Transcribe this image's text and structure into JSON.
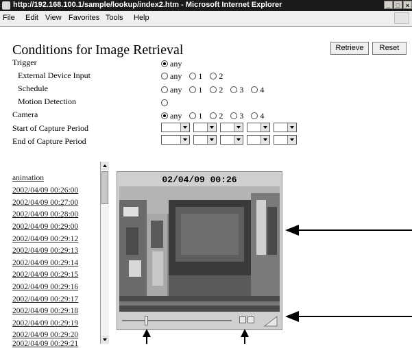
{
  "window": {
    "title": "http://192.168.100.1/sample/lookup/index2.htm - Microsoft Internet Explorer",
    "controls": [
      "_",
      "□",
      "×"
    ]
  },
  "menu": [
    "File",
    "Edit",
    "View",
    "Favorites",
    "Tools",
    "Help"
  ],
  "page": {
    "title": "Conditions for Image Retrieval",
    "buttons": {
      "retrieve": "Retrieve",
      "reset": "Reset"
    },
    "rows": [
      {
        "label": "Trigger",
        "options": [
          "any"
        ],
        "selected": 0
      },
      {
        "label": "External Device Input",
        "options": [
          "any",
          "1",
          "2"
        ],
        "selected": -1
      },
      {
        "label": "Schedule",
        "options": [
          "any",
          "1",
          "2",
          "3",
          "4"
        ],
        "selected": -1
      },
      {
        "label": "Motion Detection",
        "options": [
          ""
        ],
        "selected": -1
      },
      {
        "label": "Camera",
        "options": [
          "any",
          "1",
          "2",
          "3",
          "4"
        ],
        "selected": 0
      }
    ],
    "period_labels": [
      "Start of Capture Period",
      "End of Capture Period"
    ]
  },
  "list": {
    "items": [
      "animation",
      "2002/04/09 00:26:00",
      "2002/04/09 00:27:00",
      "2002/04/09 00:28:00",
      "2002/04/09 00:29:00",
      "2002/04/09 00:29:12",
      "2002/04/09 00:29:13",
      "2002/04/09 00:29:14",
      "2002/04/09 00:29:15",
      "2002/04/09 00:29:16",
      "2002/04/09 00:29:17",
      "2002/04/09 00:29:18",
      "2002/04/09 00:29:19",
      "2002/04/09 00:29:20",
      "2002/04/09 00:29:21"
    ]
  },
  "viewer": {
    "timestamp": "02/04/09 00:26",
    "slider_position": 0.22
  }
}
